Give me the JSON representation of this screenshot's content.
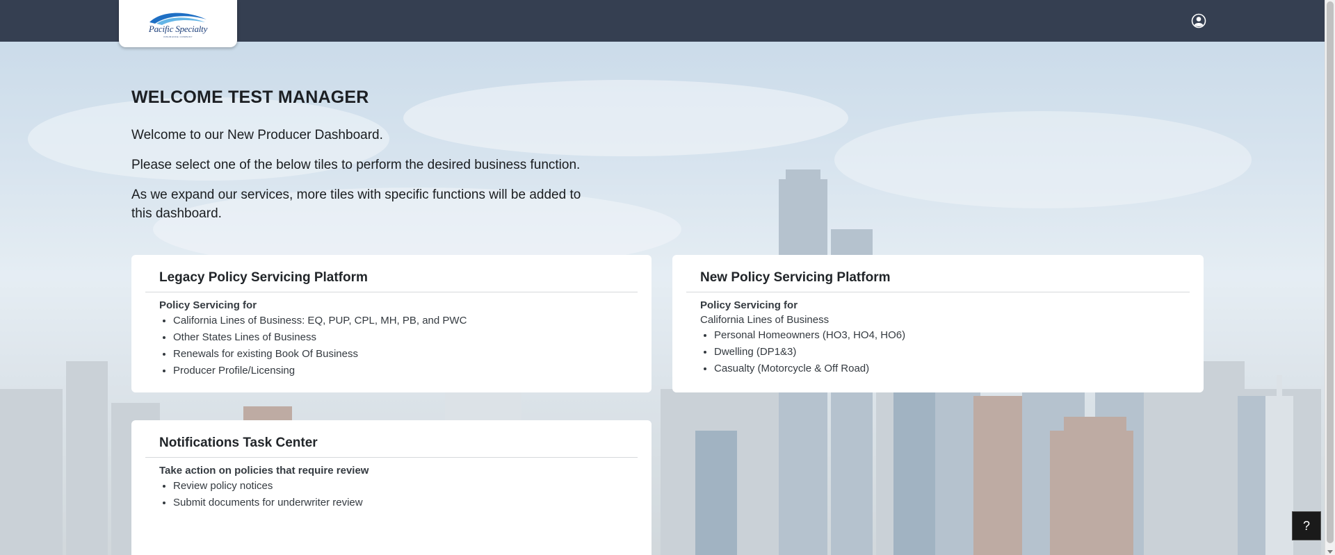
{
  "header": {
    "logo_text": "Pacific Specialty",
    "logo_subtext": "INSURANCE COMPANY",
    "user_icon": "user-circle-icon"
  },
  "main": {
    "welcome_title": "WELCOME TEST MANAGER",
    "paragraphs": [
      "Welcome to our New Producer Dashboard.",
      "Please select one of the below tiles to perform the desired business function.",
      "As we expand our services, more tiles with specific functions will be added to this dashboard."
    ]
  },
  "tiles": {
    "legacy": {
      "title": "Legacy Policy Servicing Platform",
      "subtitle": "Policy Servicing for",
      "items": [
        "California Lines of Business: EQ, PUP, CPL, MH, PB, and PWC",
        "Other States Lines of Business",
        "Renewals for existing Book Of Business",
        "Producer Profile/Licensing"
      ]
    },
    "new": {
      "title": "New Policy Servicing Platform",
      "subtitle": "Policy Servicing for",
      "line": "California Lines of Business",
      "items": [
        "Personal Homeowners (HO3, HO4, HO6)",
        "Dwelling (DP1&3)",
        "Casualty (Motorcycle & Off Road)"
      ]
    },
    "notifications": {
      "title": "Notifications Task Center",
      "subtitle": "Take action on policies that require review",
      "items": [
        "Review policy notices",
        "Submit documents for underwriter review"
      ]
    }
  },
  "help": {
    "label": "?",
    "icon": "help-icon"
  },
  "colors": {
    "header_bg": "#353f51",
    "card_bg": "#ffffff",
    "logo_blue": "#1d3f7a"
  }
}
